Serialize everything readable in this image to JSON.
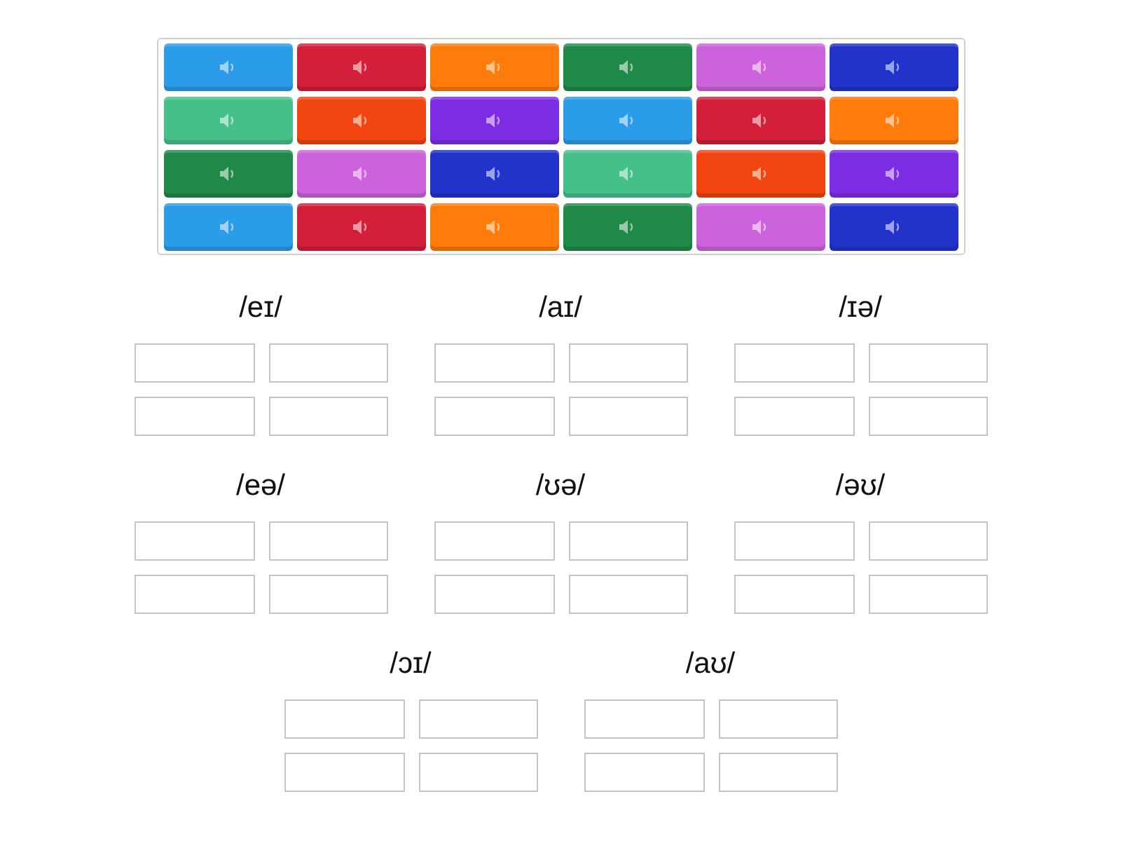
{
  "tiles": [
    {
      "color": "#2a9ce8"
    },
    {
      "color": "#d41f3a"
    },
    {
      "color": "#ff7b0a"
    },
    {
      "color": "#1f8a48"
    },
    {
      "color": "#cd63dc"
    },
    {
      "color": "#2233cc"
    },
    {
      "color": "#46c08b"
    },
    {
      "color": "#f24511"
    },
    {
      "color": "#7c2ce3"
    },
    {
      "color": "#2a9ce8"
    },
    {
      "color": "#d41f3a"
    },
    {
      "color": "#ff7b0a"
    },
    {
      "color": "#1f8a48"
    },
    {
      "color": "#cd63dc"
    },
    {
      "color": "#2233cc"
    },
    {
      "color": "#46c08b"
    },
    {
      "color": "#f24511"
    },
    {
      "color": "#7c2ce3"
    },
    {
      "color": "#2a9ce8"
    },
    {
      "color": "#d41f3a"
    },
    {
      "color": "#ff7b0a"
    },
    {
      "color": "#1f8a48"
    },
    {
      "color": "#cd63dc"
    },
    {
      "color": "#2233cc"
    }
  ],
  "groups": [
    {
      "heading": "/eɪ/"
    },
    {
      "heading": "/aɪ/"
    },
    {
      "heading": "/ɪə/"
    },
    {
      "heading": "/eə/"
    },
    {
      "heading": "/ʊə/"
    },
    {
      "heading": "/əʊ/"
    },
    {
      "heading": "/ɔɪ/"
    },
    {
      "heading": "/aʊ/"
    }
  ]
}
